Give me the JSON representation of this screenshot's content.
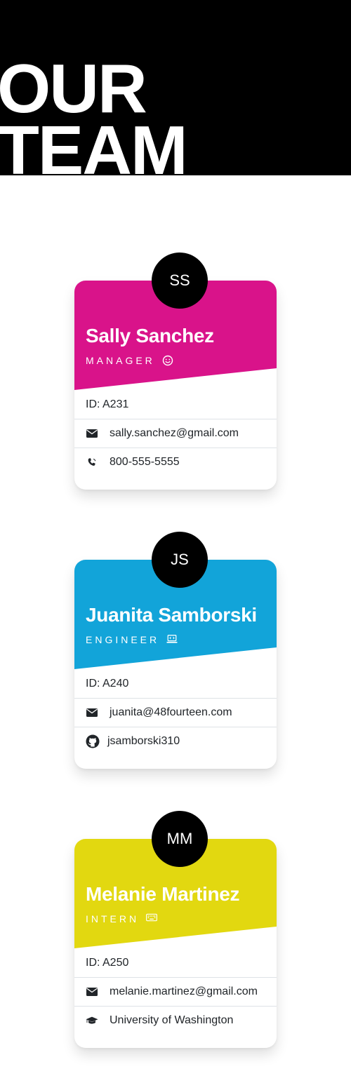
{
  "header": {
    "title": "OUR TEAM"
  },
  "cards": [
    {
      "initials": "SS",
      "name": "Sally Sanchez",
      "role": "MANAGER",
      "role_icon": "smile-icon",
      "color": "#d9138a",
      "id_label": "ID: A231",
      "email": "sally.sanchez@gmail.com",
      "extra_icon": "phone-icon",
      "extra": "800-555-5555"
    },
    {
      "initials": "JS",
      "name": "Juanita Samborski",
      "role": "ENGINEER",
      "role_icon": "laptop-code-icon",
      "color": "#12a4d9",
      "id_label": "ID: A240",
      "email": "juanita@48fourteen.com",
      "extra_icon": "github-icon",
      "extra": "jsamborski310"
    },
    {
      "initials": "MM",
      "name": "Melanie Martinez",
      "role": "INTERN",
      "role_icon": "keyboard-icon",
      "color": "#e2d810",
      "id_label": "ID: A250",
      "email": "melanie.martinez@gmail.com",
      "extra_icon": "graduation-cap-icon",
      "extra": "University of Washington"
    }
  ]
}
